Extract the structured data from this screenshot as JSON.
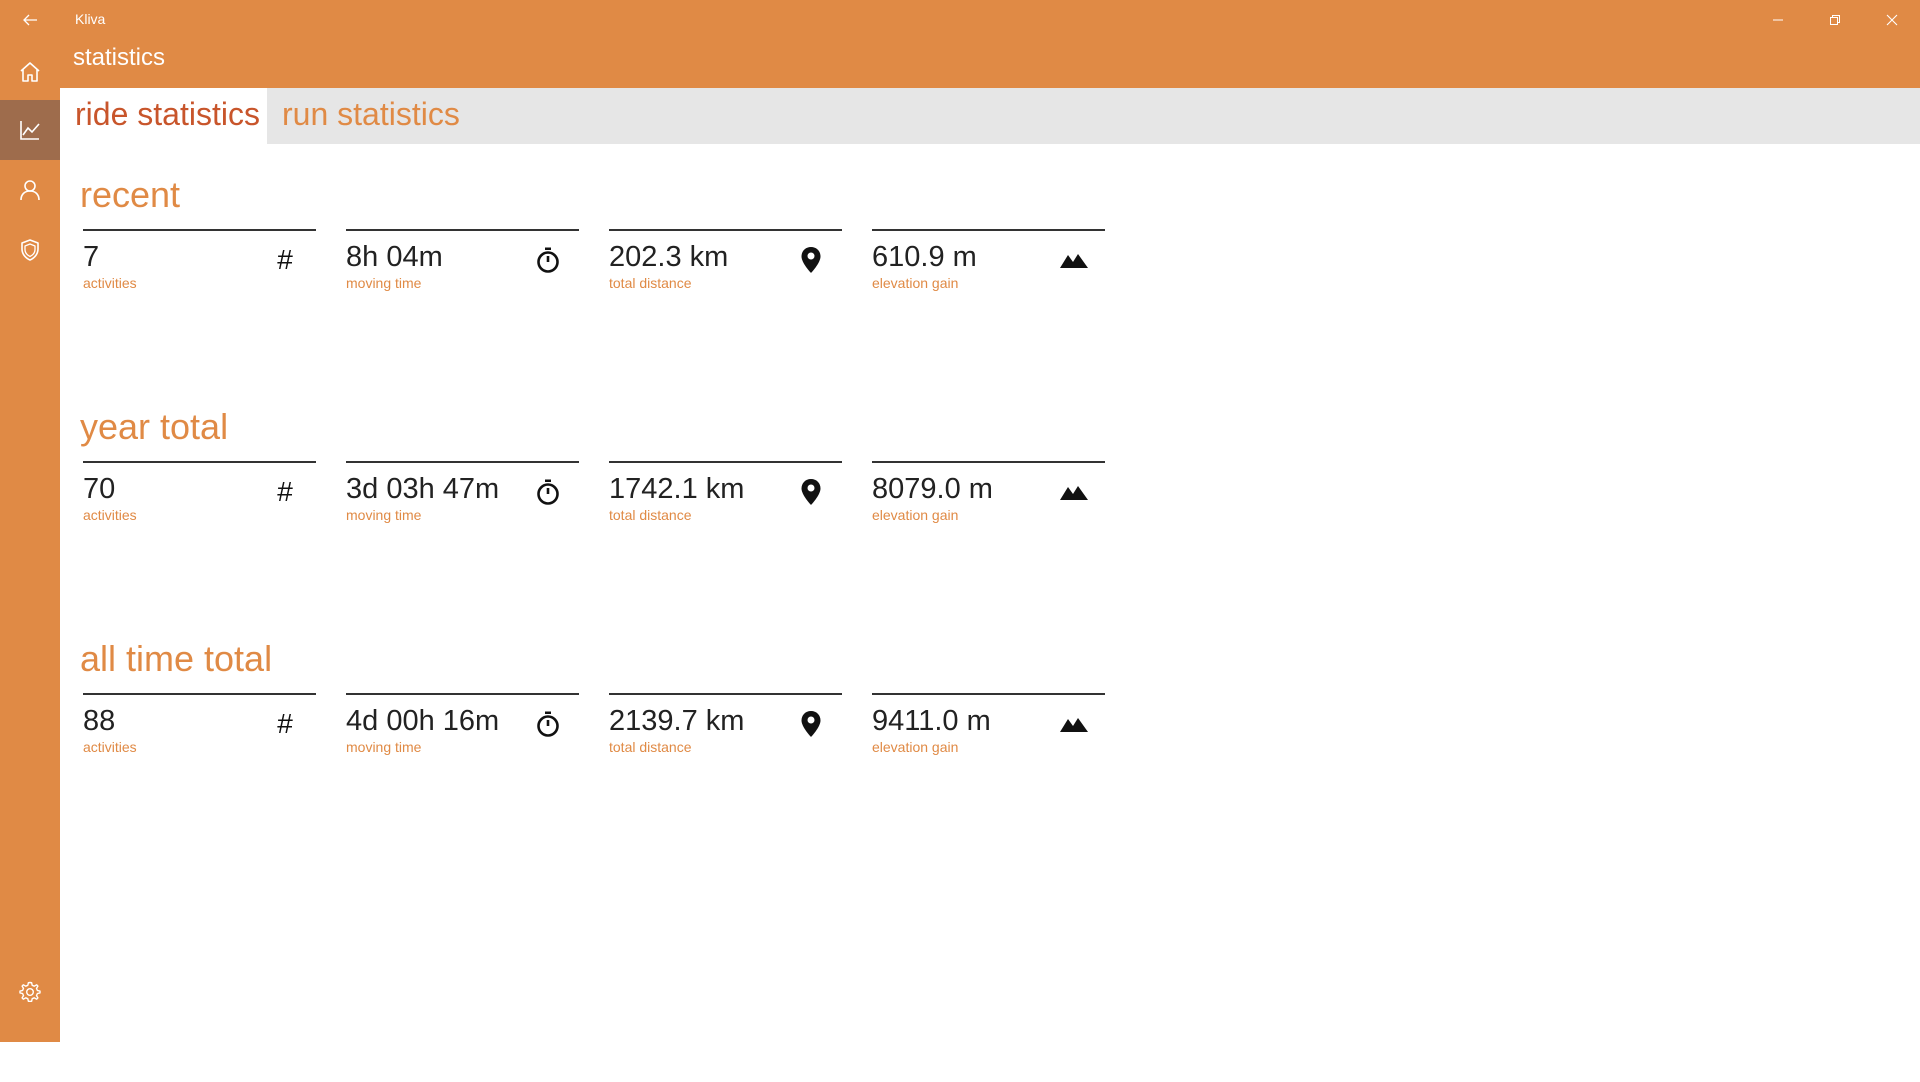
{
  "window": {
    "app_title": "Kliva"
  },
  "header": {
    "title": "statistics"
  },
  "sidebar": {
    "items": [
      {
        "icon": "home-icon"
      },
      {
        "icon": "chart-icon",
        "active": true
      },
      {
        "icon": "person-icon"
      },
      {
        "icon": "shield-icon"
      }
    ],
    "bottom": [
      {
        "icon": "gear-icon"
      },
      {
        "icon": "hamburger-menu-icon"
      }
    ]
  },
  "tabs": [
    {
      "label": "ride statistics",
      "active": true
    },
    {
      "label": "run statistics",
      "active": false
    }
  ],
  "colors": {
    "accent": "#E08A45",
    "active_tab_text": "#C8552B",
    "nav_active": "#9E6C4C"
  },
  "sections": [
    {
      "title": "recent",
      "stats": [
        {
          "value": "7",
          "label": "activities",
          "icon": "hash-icon",
          "glyph": "#"
        },
        {
          "value": "8h 04m",
          "label": "moving time",
          "icon": "stopwatch-icon"
        },
        {
          "value": "202.3 km",
          "label": "total distance",
          "icon": "map-pin-icon"
        },
        {
          "value": "610.9 m",
          "label": "elevation gain",
          "icon": "mountain-icon"
        }
      ]
    },
    {
      "title": "year total",
      "stats": [
        {
          "value": "70",
          "label": "activities",
          "icon": "hash-icon",
          "glyph": "#"
        },
        {
          "value": "3d 03h 47m",
          "label": "moving time",
          "icon": "stopwatch-icon"
        },
        {
          "value": "1742.1 km",
          "label": "total distance",
          "icon": "map-pin-icon"
        },
        {
          "value": "8079.0 m",
          "label": "elevation gain",
          "icon": "mountain-icon"
        }
      ]
    },
    {
      "title": "all time total",
      "stats": [
        {
          "value": "88",
          "label": "activities",
          "icon": "hash-icon",
          "glyph": "#"
        },
        {
          "value": "4d 00h 16m",
          "label": "moving time",
          "icon": "stopwatch-icon"
        },
        {
          "value": "2139.7 km",
          "label": "total distance",
          "icon": "map-pin-icon"
        },
        {
          "value": "9411.0 m",
          "label": "elevation gain",
          "icon": "mountain-icon"
        }
      ]
    }
  ]
}
